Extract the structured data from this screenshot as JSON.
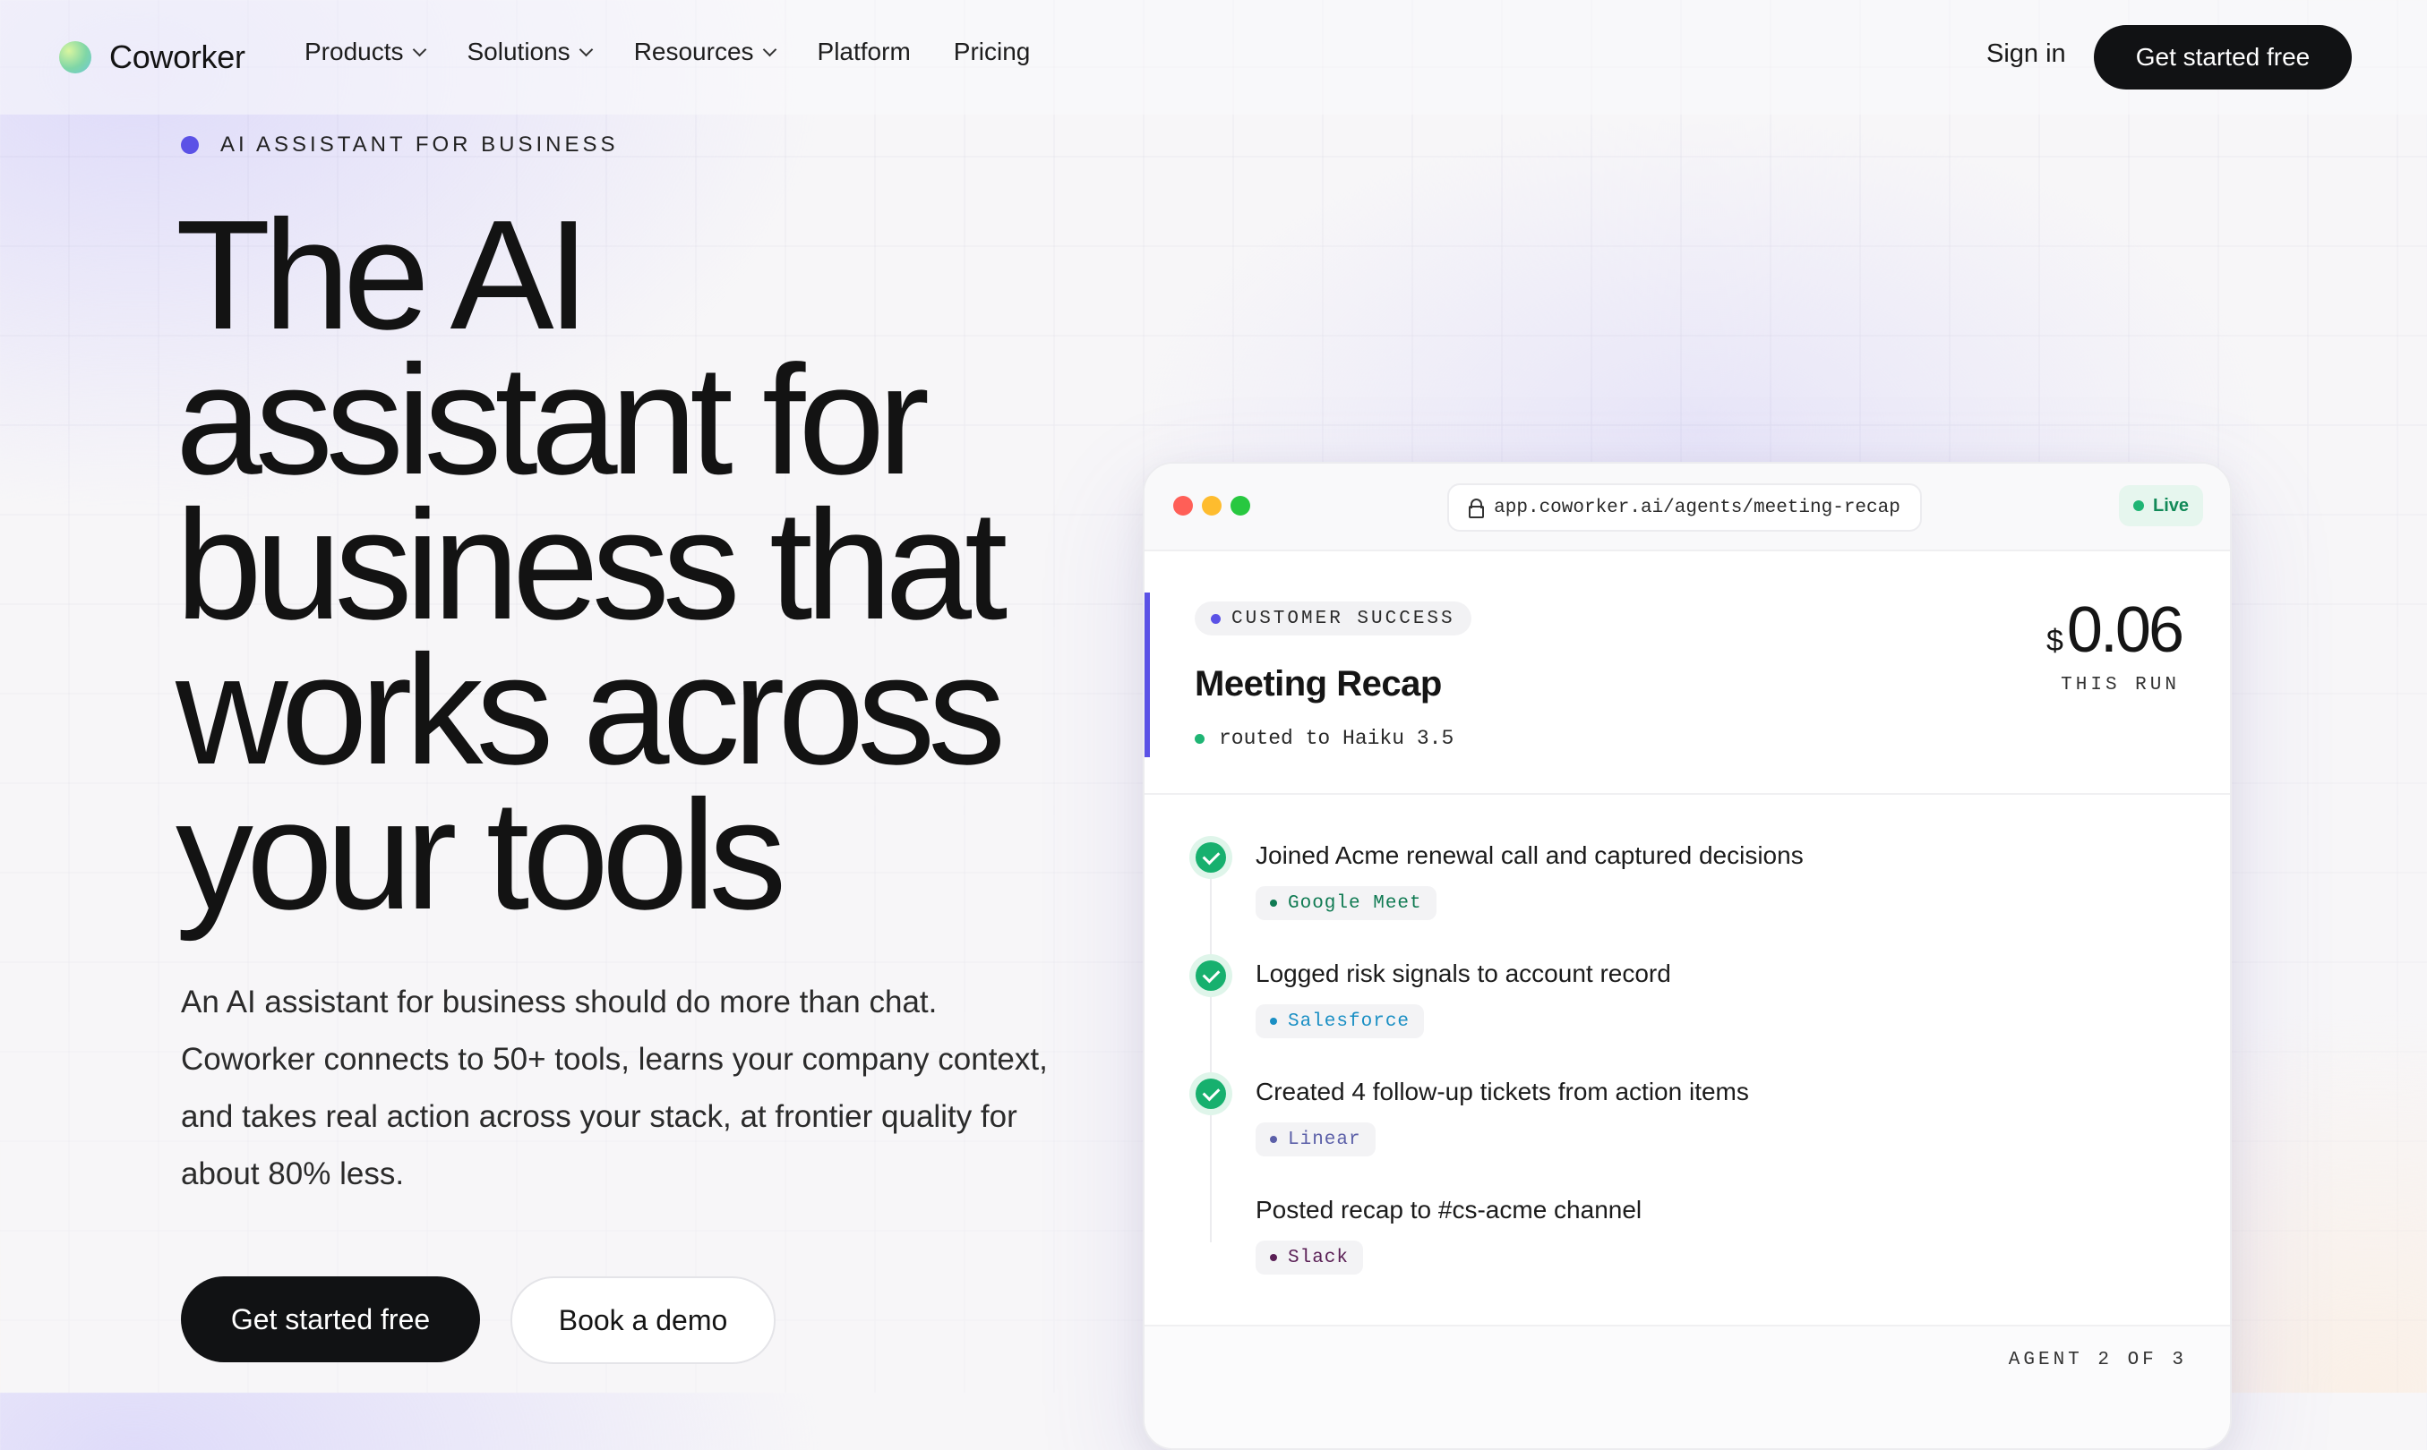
{
  "nav": {
    "brand": "Coworker",
    "links": [
      {
        "label": "Products",
        "dropdown": true
      },
      {
        "label": "Solutions",
        "dropdown": true
      },
      {
        "label": "Resources",
        "dropdown": true
      },
      {
        "label": "Platform",
        "dropdown": false
      },
      {
        "label": "Pricing",
        "dropdown": false
      }
    ],
    "sign_in": "Sign in",
    "cta": "Get started free"
  },
  "hero": {
    "eyebrow": "AI ASSISTANT FOR BUSINESS",
    "headline_lines": [
      "The AI",
      "assistant for",
      "business that",
      "works across",
      "your tools"
    ],
    "subcopy": "An AI assistant for business should do more than chat. Coworker connects to 50+ tools, learns your company context, and takes real action across your stack, at frontier quality for about 80% less.",
    "primary_cta": "Get started free",
    "secondary_cta": "Book a demo"
  },
  "panel": {
    "url": "app.coworker.ai/agents/meeting-recap",
    "status": "Live",
    "category": "CUSTOMER SUCCESS",
    "title": "Meeting Recap",
    "routed": "routed to Haiku 3.5",
    "cost_currency": "$",
    "cost_value": "0.06",
    "cost_label": "THIS RUN",
    "steps": [
      {
        "text": "Joined Acme renewal call and captured decisions",
        "tag": "Google Meet",
        "done": true
      },
      {
        "text": "Logged risk signals to account record",
        "tag": "Salesforce",
        "done": true
      },
      {
        "text": "Created 4 follow-up tickets from action items",
        "tag": "Linear",
        "done": true
      },
      {
        "text": "Posted recap to #cs-acme channel",
        "tag": "Slack",
        "done": false
      }
    ],
    "agent_count": "AGENT 2 OF 3"
  },
  "colors": {
    "accent": "#5b52e6",
    "success": "#17b06e",
    "dark": "#111214",
    "tag_google_meet": "#0f7a52",
    "tag_salesforce": "#1a8fc4",
    "tag_linear": "#5b5fa8",
    "tag_slack": "#5a1f55"
  },
  "icons": {
    "brand": "logo-orb-icon",
    "dropdown": "chevron-down-icon",
    "lock": "lock-icon",
    "step": "check-circle-icon"
  }
}
